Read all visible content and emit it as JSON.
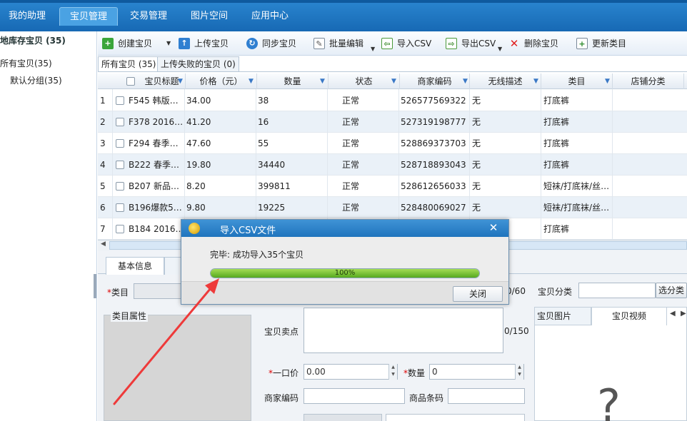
{
  "nav": {
    "items": [
      {
        "label": "我的助理"
      },
      {
        "label": "宝贝管理"
      },
      {
        "label": "交易管理"
      },
      {
        "label": "图片空间"
      },
      {
        "label": "应用中心"
      }
    ]
  },
  "tree": {
    "title": "地库存宝贝 (35)",
    "items": [
      {
        "label": "所有宝贝(35)"
      },
      {
        "label": "默认分组(35)"
      }
    ]
  },
  "toolbar": {
    "create": "创建宝贝",
    "upload": "上传宝贝",
    "sync": "同步宝贝",
    "batch_edit": "批量编辑",
    "import_csv": "导入CSV",
    "export_csv": "导出CSV",
    "delete": "删除宝贝",
    "update_category": "更新类目"
  },
  "tabs": {
    "all": "所有宝贝 (35)",
    "failed": "上传失败的宝贝 (0)"
  },
  "table": {
    "headers": {
      "title": "宝贝标题",
      "price": "价格（元）",
      "qty": "数量",
      "status": "状态",
      "code": "商家编码",
      "wireless": "无线描述",
      "category": "类目",
      "shop_cat": "店铺分类"
    },
    "rows": [
      {
        "idx": "1",
        "title": "F545 韩版…",
        "price": "34.00",
        "qty": "38",
        "status": "正常",
        "code": "526577569322",
        "wireless": "无",
        "category": "打底裤"
      },
      {
        "idx": "2",
        "title": "F378 2016…",
        "price": "41.20",
        "qty": "16",
        "status": "正常",
        "code": "527319198777",
        "wireless": "无",
        "category": "打底裤"
      },
      {
        "idx": "3",
        "title": "F294 春季…",
        "price": "47.60",
        "qty": "55",
        "status": "正常",
        "code": "528869373703",
        "wireless": "无",
        "category": "打底裤"
      },
      {
        "idx": "4",
        "title": "B222 春季…",
        "price": "19.80",
        "qty": "34440",
        "status": "正常",
        "code": "528718893043",
        "wireless": "无",
        "category": "打底裤"
      },
      {
        "idx": "5",
        "title": "B207 新品…",
        "price": "8.20",
        "qty": "399811",
        "status": "正常",
        "code": "528612656033",
        "wireless": "无",
        "category": "短袜/打底袜/丝…"
      },
      {
        "idx": "6",
        "title": "B196爆款5…",
        "price": "9.80",
        "qty": "19225",
        "status": "正常",
        "code": "528480069027",
        "wireless": "无",
        "category": "短袜/打底袜/丝…"
      },
      {
        "idx": "7",
        "title": "B184 2016…",
        "price": "",
        "qty": "",
        "status": "",
        "code": "",
        "wireless": "",
        "category": "打底裤"
      }
    ]
  },
  "form": {
    "tab_basic": "基本信息",
    "category_label": "类目",
    "count_title": "0/60",
    "shop_category_label": "宝贝分类",
    "choose_category": "选分类",
    "category_attr": "类目属性",
    "selling_point_label": "宝贝卖点",
    "count_selling": "0/150",
    "price_label": "一口价",
    "price_value": "0.00",
    "qty_label": "数量",
    "qty_value": "0",
    "merchant_code_label": "商家编码",
    "barcode_label": "商品条码",
    "images_tab": "宝贝图片",
    "video_tab": "宝贝视频",
    "placeholder_glyph": "?"
  },
  "dialog": {
    "title": "导入CSV文件",
    "message": "完毕: 成功导入35个宝贝",
    "progress": 1.0,
    "progress_text": "100%",
    "close_button": "关闭"
  },
  "colors": {
    "nav_bg": "#1d75c2",
    "progress_green": "#6cbf2a",
    "arrow_red": "#ee3a3a"
  }
}
